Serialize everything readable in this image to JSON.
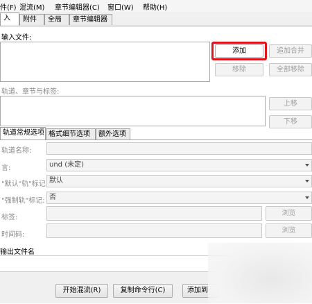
{
  "menu": [
    "件(F)",
    "混流(M)",
    "章节编辑器(C)",
    "窗口(W)",
    "帮助(H)"
  ],
  "top_tabs": [
    "入",
    "附件",
    "全局",
    "章节编辑器"
  ],
  "input": {
    "files_label": "输入文件:",
    "add_button": "添加",
    "append_button": "追加合并",
    "remove_button": "移除",
    "remove_all_button": "全部移除",
    "tracks_label": "轨道、章节与标签:",
    "up_button": "上移",
    "down_button": "下移"
  },
  "sub_tabs": [
    "轨道常规选项",
    "格式细节选项",
    "额外选项"
  ],
  "options": {
    "track_name": "轨道名称:",
    "language": "言:",
    "language_value": "und (未定)",
    "default_flag": "\"默认\"轨\"标记:",
    "default_value": "默认",
    "forced_flag": "\"强制轨\"标记:",
    "forced_value": "否",
    "tags": "标签:",
    "timecodes": "时间码:",
    "browse1": "浏览",
    "browse2": "浏览"
  },
  "output": {
    "label": "输出文件名",
    "start_mux": "开始混流(R)",
    "copy_cmd": "复制命令行(C)",
    "add_job": "添加到"
  },
  "highlight_color": "#e0141a"
}
